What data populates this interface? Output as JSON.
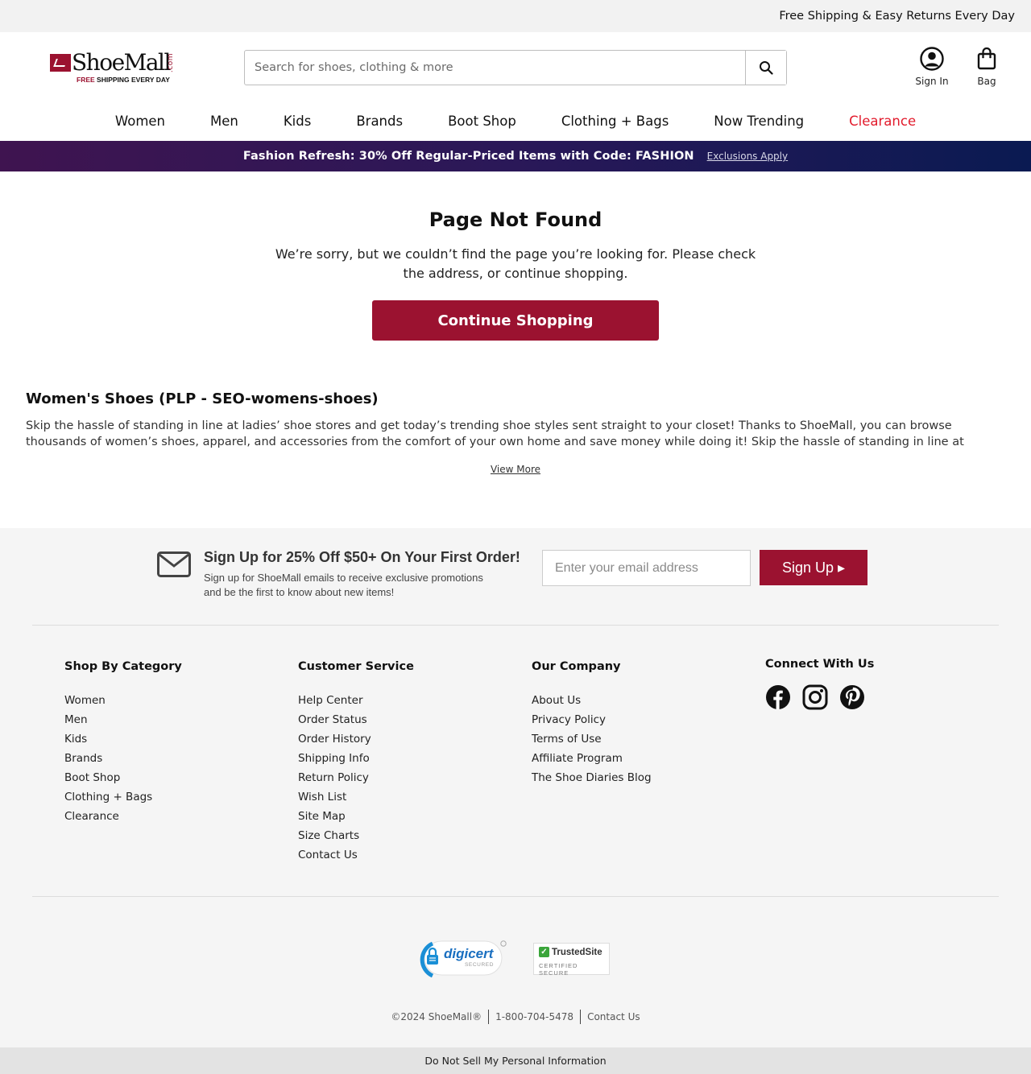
{
  "topbar": {
    "text": "Free Shipping & Easy Returns Every Day"
  },
  "brand": {
    "name": "ShoeMall",
    "suffix": ".com",
    "tagline_free": "FREE",
    "tagline_rest": " SHIPPING EVERY DAY",
    "primary_color": "#9b1230"
  },
  "search": {
    "placeholder": "Search for shoes, clothing & more",
    "icon": "search-icon"
  },
  "header_actions": {
    "sign_in": "Sign In",
    "bag": "Bag"
  },
  "nav": {
    "women": "Women",
    "men": "Men",
    "kids": "Kids",
    "brands": "Brands",
    "boot_shop": "Boot Shop",
    "clothing_bags": "Clothing + Bags",
    "now_trending": "Now Trending",
    "clearance": "Clearance",
    "clearance_color": "#e21b2c"
  },
  "promo": {
    "text": "Fashion Refresh: 30% Off Regular-Priced Items with Code: FASHION",
    "link": "Exclusions Apply"
  },
  "not_found": {
    "title": "Page Not Found",
    "message": "We’re sorry, but we couldn’t find the page you’re looking for. Please check the address, or continue shopping.",
    "button": "Continue Shopping"
  },
  "seo": {
    "title": "Women's Shoes (PLP - SEO-womens-shoes)",
    "text": "Skip the hassle of standing in line at ladies’ shoe stores and get today’s trending shoe styles sent straight to your closet! Thanks to ShoeMall, you can browse thousands of women’s shoes, apparel, and accessories from the comfort of your own home and save money while doing it! Skip the hassle of standing in line at ladies’ shoe stores and get…",
    "view_more": "View More"
  },
  "signup": {
    "title": "Sign Up for 25% Off $50+ On Your First Order!",
    "desc": "Sign up for ShoeMall emails to receive exclusive promotions and be the first to know about new items!",
    "placeholder": "Enter your email address",
    "button": "Sign Up ▸"
  },
  "footer": {
    "shop": {
      "title": "Shop By Category",
      "items": {
        "0": "Women",
        "1": "Men",
        "2": "Kids",
        "3": "Brands",
        "4": "Boot Shop",
        "5": "Clothing + Bags",
        "6": "Clearance"
      }
    },
    "service": {
      "title": "Customer Service",
      "items": {
        "0": "Help Center",
        "1": "Order Status",
        "2": "Order History",
        "3": "Shipping Info",
        "4": "Return Policy",
        "5": "Wish List",
        "6": "Site Map",
        "7": "Size Charts",
        "8": "Contact Us"
      }
    },
    "company": {
      "title": "Our Company",
      "items": {
        "0": "About Us",
        "1": "Privacy Policy",
        "2": "Terms of Use",
        "3": "Affiliate Program",
        "4": "The Shoe Diaries Blog"
      }
    },
    "connect": {
      "title": "Connect With Us",
      "icons": [
        "facebook-icon",
        "instagram-icon",
        "pinterest-icon"
      ]
    }
  },
  "badges": {
    "digicert": "digicert",
    "digicert_sub": "SECURED",
    "trusted": "TrustedSite",
    "trusted_sub": "CERTIFIED SECURE"
  },
  "legal": {
    "copyright": "©2024 ShoeMall®",
    "phone": "1-800-704-5478",
    "contact": "Contact Us"
  },
  "bottom": {
    "text": "Do Not Sell My Personal Information"
  }
}
